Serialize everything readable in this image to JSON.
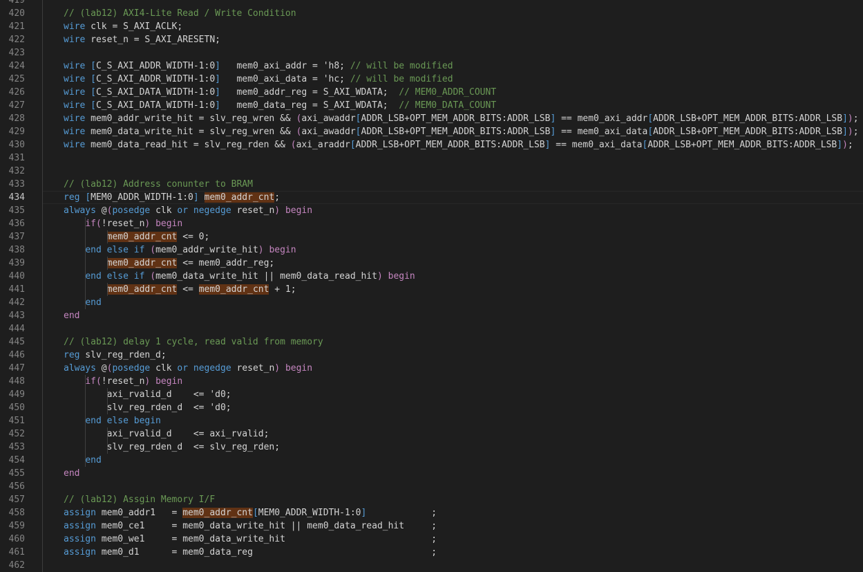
{
  "editor": {
    "current_line": 434,
    "lines": [
      {
        "n": 419,
        "segs": []
      },
      {
        "n": 420,
        "segs": [
          {
            "t": "// (lab12) AXI4-Lite Read / Write Condition",
            "c": "cm"
          }
        ]
      },
      {
        "n": 421,
        "segs": [
          {
            "t": "wire",
            "c": "kw"
          },
          {
            "t": " clk = S_AXI_ACLK;"
          }
        ]
      },
      {
        "n": 422,
        "segs": [
          {
            "t": "wire",
            "c": "kw"
          },
          {
            "t": " reset_n = S_AXI_ARESETN;"
          }
        ]
      },
      {
        "n": 423,
        "segs": []
      },
      {
        "n": 424,
        "segs": [
          {
            "t": "wire",
            "c": "kw"
          },
          {
            "t": " "
          },
          {
            "t": "[",
            "c": "br"
          },
          {
            "t": "C_S_AXI_ADDR_WIDTH-1:0"
          },
          {
            "t": "]",
            "c": "br"
          },
          {
            "t": "   mem0_axi_addr = 'h8; "
          },
          {
            "t": "// will be modified",
            "c": "cm"
          }
        ]
      },
      {
        "n": 425,
        "segs": [
          {
            "t": "wire",
            "c": "kw"
          },
          {
            "t": " "
          },
          {
            "t": "[",
            "c": "br"
          },
          {
            "t": "C_S_AXI_ADDR_WIDTH-1:0"
          },
          {
            "t": "]",
            "c": "br"
          },
          {
            "t": "   mem0_axi_data = 'hc; "
          },
          {
            "t": "// will be modified",
            "c": "cm"
          }
        ]
      },
      {
        "n": 426,
        "segs": [
          {
            "t": "wire",
            "c": "kw"
          },
          {
            "t": " "
          },
          {
            "t": "[",
            "c": "br"
          },
          {
            "t": "C_S_AXI_DATA_WIDTH-1:0"
          },
          {
            "t": "]",
            "c": "br"
          },
          {
            "t": "   mem0_addr_reg = S_AXI_WDATA;  "
          },
          {
            "t": "// MEM0_ADDR_COUNT",
            "c": "cm"
          }
        ]
      },
      {
        "n": 427,
        "segs": [
          {
            "t": "wire",
            "c": "kw"
          },
          {
            "t": " "
          },
          {
            "t": "[",
            "c": "br"
          },
          {
            "t": "C_S_AXI_DATA_WIDTH-1:0"
          },
          {
            "t": "]",
            "c": "br"
          },
          {
            "t": "   mem0_data_reg = S_AXI_WDATA;  "
          },
          {
            "t": "// MEM0_DATA_COUNT",
            "c": "cm"
          }
        ]
      },
      {
        "n": 428,
        "segs": [
          {
            "t": "wire",
            "c": "kw"
          },
          {
            "t": " mem0_addr_write_hit = slv_reg_wren && "
          },
          {
            "t": "(",
            "c": "ctl"
          },
          {
            "t": "axi_awaddr"
          },
          {
            "t": "[",
            "c": "br"
          },
          {
            "t": "ADDR_LSB+OPT_MEM_ADDR_BITS:ADDR_LSB"
          },
          {
            "t": "]",
            "c": "br"
          },
          {
            "t": " == mem0_axi_addr"
          },
          {
            "t": "[",
            "c": "br"
          },
          {
            "t": "ADDR_LSB+OPT_MEM_ADDR_BITS:ADDR_LSB"
          },
          {
            "t": "]",
            "c": "br"
          },
          {
            "t": ")",
            "c": "ctl"
          },
          {
            "t": ";"
          }
        ]
      },
      {
        "n": 429,
        "segs": [
          {
            "t": "wire",
            "c": "kw"
          },
          {
            "t": " mem0_data_write_hit = slv_reg_wren && "
          },
          {
            "t": "(",
            "c": "ctl"
          },
          {
            "t": "axi_awaddr"
          },
          {
            "t": "[",
            "c": "br"
          },
          {
            "t": "ADDR_LSB+OPT_MEM_ADDR_BITS:ADDR_LSB"
          },
          {
            "t": "]",
            "c": "br"
          },
          {
            "t": " == mem0_axi_data"
          },
          {
            "t": "[",
            "c": "br"
          },
          {
            "t": "ADDR_LSB+OPT_MEM_ADDR_BITS:ADDR_LSB"
          },
          {
            "t": "]",
            "c": "br"
          },
          {
            "t": ")",
            "c": "ctl"
          },
          {
            "t": ";"
          }
        ]
      },
      {
        "n": 430,
        "segs": [
          {
            "t": "wire",
            "c": "kw"
          },
          {
            "t": " mem0_data_read_hit = slv_reg_rden && "
          },
          {
            "t": "(",
            "c": "ctl"
          },
          {
            "t": "axi_araddr"
          },
          {
            "t": "[",
            "c": "br"
          },
          {
            "t": "ADDR_LSB+OPT_MEM_ADDR_BITS:ADDR_LSB"
          },
          {
            "t": "]",
            "c": "br"
          },
          {
            "t": " == mem0_axi_data"
          },
          {
            "t": "[",
            "c": "br"
          },
          {
            "t": "ADDR_LSB+OPT_MEM_ADDR_BITS:ADDR_LSB"
          },
          {
            "t": "]",
            "c": "br"
          },
          {
            "t": ")",
            "c": "ctl"
          },
          {
            "t": ";"
          }
        ]
      },
      {
        "n": 431,
        "segs": []
      },
      {
        "n": 432,
        "segs": []
      },
      {
        "n": 433,
        "segs": [
          {
            "t": "// (lab12) Address conunter to BRAM",
            "c": "cm"
          }
        ]
      },
      {
        "n": 434,
        "segs": [
          {
            "t": "reg",
            "c": "kw"
          },
          {
            "t": " "
          },
          {
            "t": "[",
            "c": "br"
          },
          {
            "t": "MEM0_ADDR_WIDTH-1:0"
          },
          {
            "t": "]",
            "c": "br"
          },
          {
            "t": " "
          },
          {
            "t": "mem0_addr_cnt",
            "c": "hl"
          },
          {
            "t": ";"
          }
        ]
      },
      {
        "n": 435,
        "segs": [
          {
            "t": "always",
            "c": "kw"
          },
          {
            "t": " @"
          },
          {
            "t": "(",
            "c": "ctl"
          },
          {
            "t": "posedge",
            "c": "kw"
          },
          {
            "t": " clk "
          },
          {
            "t": "or",
            "c": "kw"
          },
          {
            "t": " "
          },
          {
            "t": "negedge",
            "c": "kw"
          },
          {
            "t": " reset_n"
          },
          {
            "t": ")",
            "c": "ctl"
          },
          {
            "t": " "
          },
          {
            "t": "begin",
            "c": "ctl"
          }
        ]
      },
      {
        "n": 436,
        "segs": [
          {
            "t": "    "
          },
          {
            "t": "if",
            "c": "ctl"
          },
          {
            "t": "(",
            "c": "ctl"
          },
          {
            "t": "!reset_n"
          },
          {
            "t": ")",
            "c": "ctl"
          },
          {
            "t": " "
          },
          {
            "t": "begin",
            "c": "ctl"
          }
        ]
      },
      {
        "n": 437,
        "segs": [
          {
            "t": "        "
          },
          {
            "t": "mem0_addr_cnt",
            "c": "hl"
          },
          {
            "t": " <= 0;"
          }
        ]
      },
      {
        "n": 438,
        "segs": [
          {
            "t": "    "
          },
          {
            "t": "end else if",
            "c": "kw"
          },
          {
            "t": " "
          },
          {
            "t": "(",
            "c": "ctl"
          },
          {
            "t": "mem0_addr_write_hit"
          },
          {
            "t": ")",
            "c": "ctl"
          },
          {
            "t": " "
          },
          {
            "t": "begin",
            "c": "ctl"
          }
        ]
      },
      {
        "n": 439,
        "segs": [
          {
            "t": "        "
          },
          {
            "t": "mem0_addr_cnt",
            "c": "hl"
          },
          {
            "t": " <= mem0_addr_reg;"
          }
        ]
      },
      {
        "n": 440,
        "segs": [
          {
            "t": "    "
          },
          {
            "t": "end else if",
            "c": "kw"
          },
          {
            "t": " "
          },
          {
            "t": "(",
            "c": "ctl"
          },
          {
            "t": "mem0_data_write_hit || mem0_data_read_hit"
          },
          {
            "t": ")",
            "c": "ctl"
          },
          {
            "t": " "
          },
          {
            "t": "begin",
            "c": "ctl"
          }
        ]
      },
      {
        "n": 441,
        "segs": [
          {
            "t": "        "
          },
          {
            "t": "mem0_addr_cnt",
            "c": "hl"
          },
          {
            "t": " <= "
          },
          {
            "t": "mem0_addr_cnt",
            "c": "hl"
          },
          {
            "t": " + 1;"
          }
        ]
      },
      {
        "n": 442,
        "segs": [
          {
            "t": "    "
          },
          {
            "t": "end",
            "c": "kw"
          }
        ]
      },
      {
        "n": 443,
        "segs": [
          {
            "t": "end",
            "c": "ctl"
          }
        ]
      },
      {
        "n": 444,
        "segs": []
      },
      {
        "n": 445,
        "segs": [
          {
            "t": "// (lab12) delay 1 cycle, read valid from memory",
            "c": "cm"
          }
        ]
      },
      {
        "n": 446,
        "segs": [
          {
            "t": "reg",
            "c": "kw"
          },
          {
            "t": " slv_reg_rden_d;"
          }
        ]
      },
      {
        "n": 447,
        "segs": [
          {
            "t": "always",
            "c": "kw"
          },
          {
            "t": " @"
          },
          {
            "t": "(",
            "c": "ctl"
          },
          {
            "t": "posedge",
            "c": "kw"
          },
          {
            "t": " clk "
          },
          {
            "t": "or",
            "c": "kw"
          },
          {
            "t": " "
          },
          {
            "t": "negedge",
            "c": "kw"
          },
          {
            "t": " reset_n"
          },
          {
            "t": ")",
            "c": "ctl"
          },
          {
            "t": " "
          },
          {
            "t": "begin",
            "c": "ctl"
          }
        ]
      },
      {
        "n": 448,
        "segs": [
          {
            "t": "    "
          },
          {
            "t": "if",
            "c": "ctl"
          },
          {
            "t": "(",
            "c": "ctl"
          },
          {
            "t": "!reset_n"
          },
          {
            "t": ")",
            "c": "ctl"
          },
          {
            "t": " "
          },
          {
            "t": "begin",
            "c": "ctl"
          }
        ]
      },
      {
        "n": 449,
        "segs": [
          {
            "t": "        axi_rvalid_d    <= 'd0;"
          }
        ]
      },
      {
        "n": 450,
        "segs": [
          {
            "t": "        slv_reg_rden_d  <= 'd0;"
          }
        ]
      },
      {
        "n": 451,
        "segs": [
          {
            "t": "    "
          },
          {
            "t": "end else begin",
            "c": "kw"
          }
        ]
      },
      {
        "n": 452,
        "segs": [
          {
            "t": "        axi_rvalid_d    <= axi_rvalid;"
          }
        ]
      },
      {
        "n": 453,
        "segs": [
          {
            "t": "        slv_reg_rden_d  <= slv_reg_rden;"
          }
        ]
      },
      {
        "n": 454,
        "segs": [
          {
            "t": "    "
          },
          {
            "t": "end",
            "c": "kw"
          }
        ]
      },
      {
        "n": 455,
        "segs": [
          {
            "t": "end",
            "c": "ctl"
          }
        ]
      },
      {
        "n": 456,
        "segs": []
      },
      {
        "n": 457,
        "segs": [
          {
            "t": "// (lab12) Assgin Memory I/F",
            "c": "cm"
          }
        ]
      },
      {
        "n": 458,
        "segs": [
          {
            "t": "assign",
            "c": "kw"
          },
          {
            "t": " mem0_addr1   = "
          },
          {
            "t": "mem0_addr_cnt",
            "c": "hl"
          },
          {
            "t": "[",
            "c": "br"
          },
          {
            "t": "MEM0_ADDR_WIDTH-1:0"
          },
          {
            "t": "]",
            "c": "br"
          },
          {
            "t": "            ;"
          }
        ]
      },
      {
        "n": 459,
        "segs": [
          {
            "t": "assign",
            "c": "kw"
          },
          {
            "t": " mem0_ce1     = mem0_data_write_hit || mem0_data_read_hit     ;"
          }
        ]
      },
      {
        "n": 460,
        "segs": [
          {
            "t": "assign",
            "c": "kw"
          },
          {
            "t": " mem0_we1     = mem0_data_write_hit                           ;"
          }
        ]
      },
      {
        "n": 461,
        "segs": [
          {
            "t": "assign",
            "c": "kw"
          },
          {
            "t": " mem0_d1      = mem0_data_reg                                 ;"
          }
        ]
      },
      {
        "n": 462,
        "segs": []
      }
    ]
  }
}
